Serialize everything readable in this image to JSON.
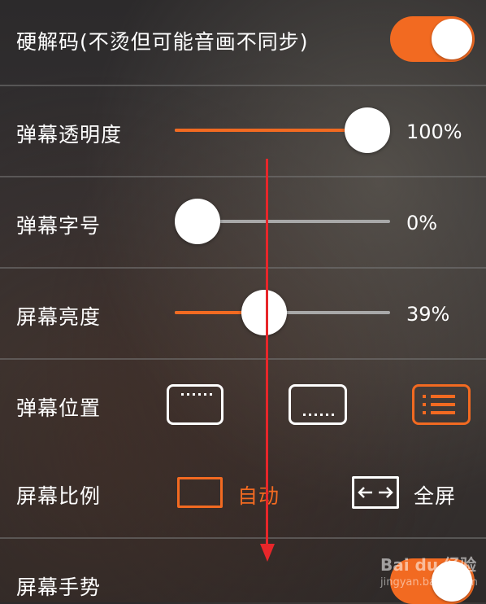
{
  "settings": {
    "hardware_decode": {
      "label": "硬解码(不烫但可能音画不同步)",
      "enabled": true
    },
    "danmaku_opacity": {
      "label": "弹幕透明度",
      "value": 100,
      "value_text": "100%"
    },
    "danmaku_font_size": {
      "label": "弹幕字号",
      "value": 0,
      "value_text": "0%"
    },
    "screen_brightness": {
      "label": "屏幕亮度",
      "value": 39,
      "value_text": "39%"
    },
    "danmaku_position": {
      "label": "弹幕位置",
      "options": [
        "top",
        "bottom",
        "full"
      ],
      "selected": "full"
    },
    "screen_ratio": {
      "label": "屏幕比例",
      "options": [
        {
          "label": "自动",
          "selected": true
        },
        {
          "label": "全屏",
          "selected": false
        }
      ]
    },
    "screen_gesture": {
      "label": "屏幕手势",
      "enabled": true
    }
  },
  "watermark": {
    "text": "Bai du 经验",
    "sub": "jingyan.baidu.com"
  },
  "colors": {
    "accent": "#f26a21",
    "arrow": "#e8262a",
    "track": "#a8a8a8"
  }
}
